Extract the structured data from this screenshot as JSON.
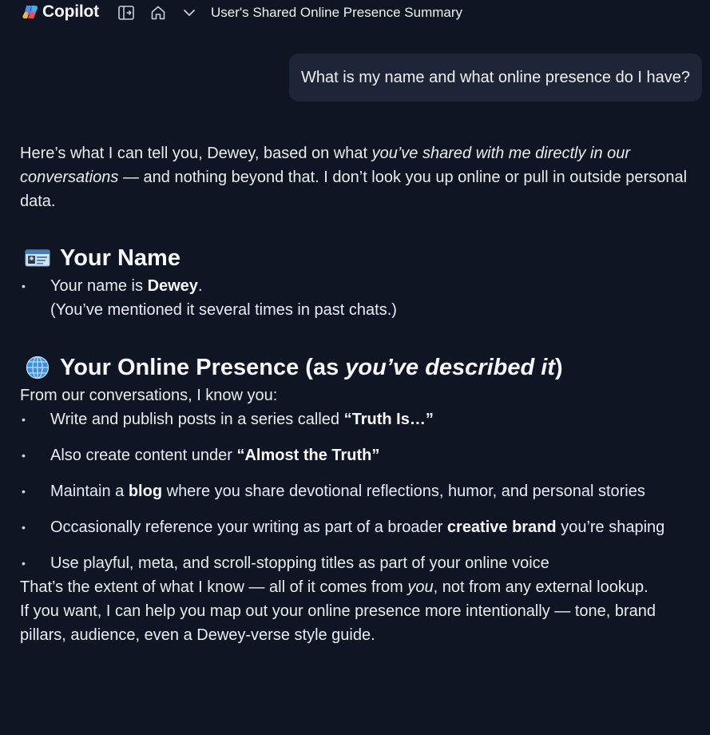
{
  "topbar": {
    "brand_name": "Copilot",
    "conversation_title": "User's Shared Online Presence Summary",
    "icons": [
      "copilot-logo-icon",
      "sidebar-toggle-icon",
      "home-icon",
      "chevron-down-icon"
    ]
  },
  "user_message": {
    "text": "What is my name and what online presence do I have?"
  },
  "answer": {
    "intro": {
      "part1": "Here’s what I can tell you, Dewey, based on what ",
      "italic": "you’ve shared with me directly in our conversations",
      "part2": " — and nothing beyond that. I don’t look you up online or pull in outside personal data."
    },
    "section_name": {
      "emoji": "id-card-icon",
      "title": "Your Name",
      "line1_prefix": "Your name is ",
      "line1_bold": "Dewey",
      "line1_suffix": ".",
      "line2": "(You’ve mentioned it several times in past chats.)"
    },
    "section_presence": {
      "emoji": "globe-icon",
      "title_prefix": "Your Online Presence (as ",
      "title_italic": "you’ve described it",
      "title_suffix": ")",
      "intro": "From our conversations, I know you:",
      "items": [
        {
          "pre": "Write and publish posts in a series called ",
          "bold": "“Truth Is…”",
          "post": ""
        },
        {
          "pre": "Also create content under ",
          "bold": "“Almost the Truth”",
          "post": ""
        },
        {
          "pre": "Maintain a ",
          "bold": "blog",
          "post": " where you share devotional reflections, humor, and personal stories"
        },
        {
          "pre": "Occasionally reference your writing as part of a broader ",
          "bold": "creative brand",
          "post": " you’re shaping"
        },
        {
          "pre": "Use playful, meta, and scroll-stopping titles as part of your online voice",
          "bold": "",
          "post": ""
        }
      ]
    },
    "outro1": {
      "pre": "That’s the extent of what I know — all of it comes from ",
      "italic": "you",
      "post": ", not from any external lookup."
    },
    "outro2": "If you want, I can help you map out your online presence more intentionally — tone, brand pillars, audience, even a Dewey-verse style guide."
  },
  "colors": {
    "background": "#0f1522",
    "bubble": "#1e2536",
    "text": "#e9ecf2"
  }
}
